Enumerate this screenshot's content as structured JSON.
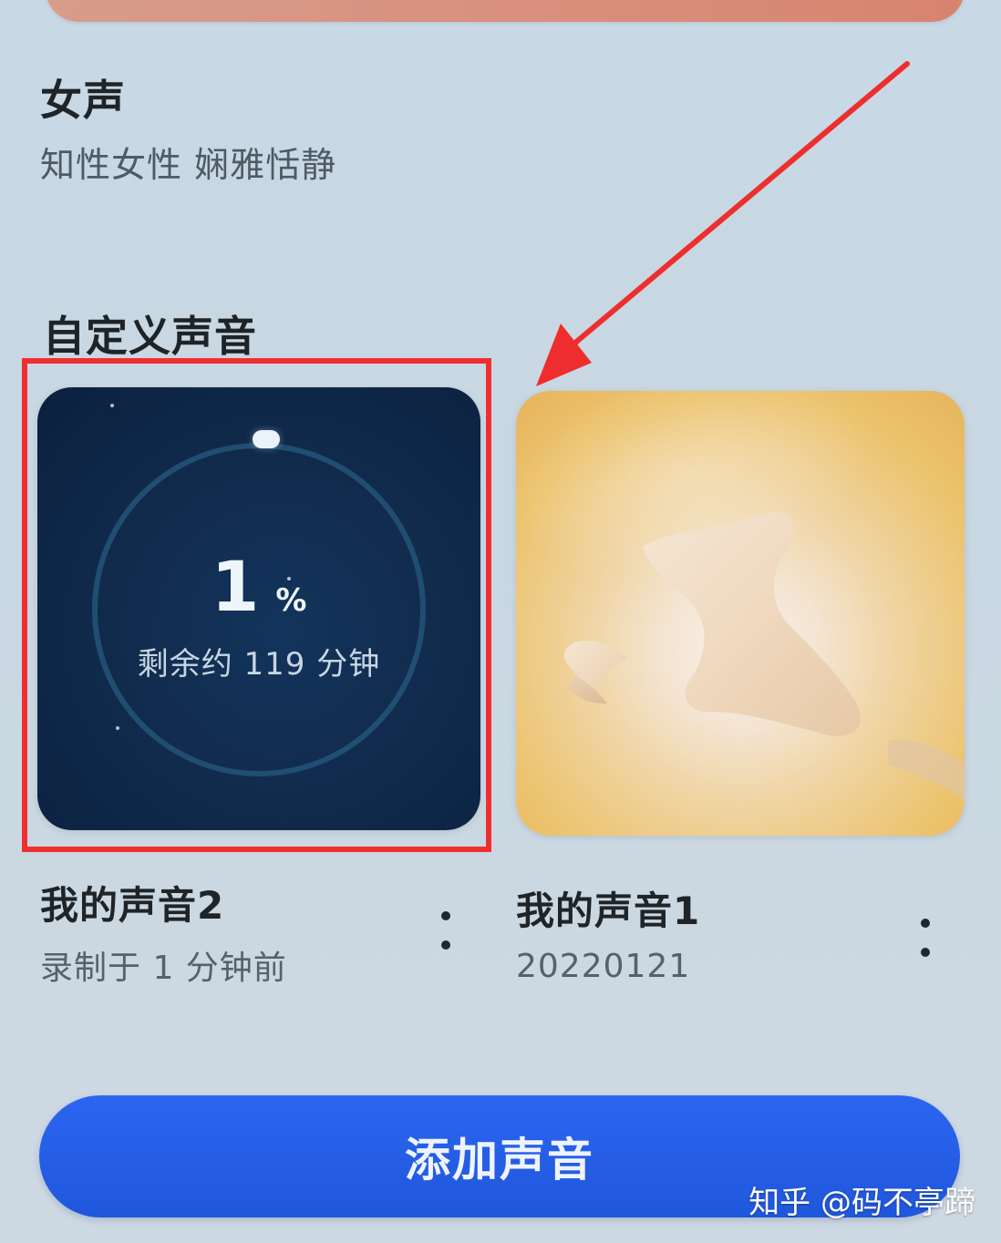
{
  "voice_option": {
    "title": "女声",
    "description": "知性女性 娴雅恬静"
  },
  "custom_section": {
    "title": "自定义声音"
  },
  "voice_cards": [
    {
      "name": "我的声音2",
      "subtitle": "录制于 1 分钟前",
      "progress_value": "1",
      "progress_unit": "%",
      "progress_fraction": 0.01,
      "remaining_text": "剩余约 119 分钟",
      "highlighted": true
    },
    {
      "name": "我的声音1",
      "subtitle": "20220121"
    }
  ],
  "actions": {
    "add_voice_label": "添加声音"
  },
  "watermark": {
    "text": "知乎 @码不亭蹄"
  },
  "icons": {
    "more": "more-vertical-icon",
    "arrow": "annotation-arrow-icon"
  },
  "colors": {
    "highlight_border": "#ef2f2f",
    "primary_button": "#2462e8",
    "progress_card": "#112b4d",
    "art_card": "#edc46d"
  }
}
